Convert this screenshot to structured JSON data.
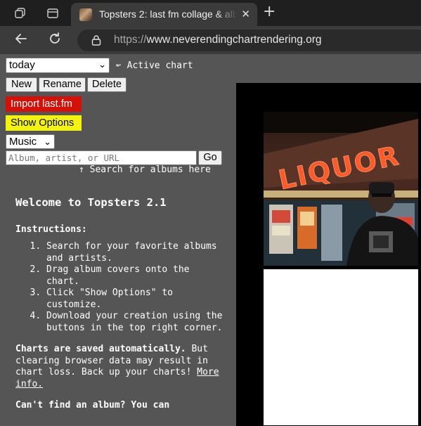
{
  "browser": {
    "tab_title": "Topsters 2: last fm collage & albu",
    "url_scheme": "https://",
    "url_host": "www.neverendingchartrendering.org"
  },
  "controls": {
    "chart_select_value": "today",
    "active_chart_label": "↜ Active chart",
    "new_label": "New",
    "rename_label": "Rename",
    "delete_label": "Delete",
    "import_label": "Import last.fm",
    "options_label": "Show Options",
    "type_select_value": "Music",
    "search_placeholder": "Album, artist, or URL",
    "go_label": "Go",
    "search_hint": "↑ Search for albums here"
  },
  "welcome": {
    "title": "Welcome to Topsters 2.1",
    "instructions_heading": "Instructions:",
    "steps": [
      "Search for your favorite albums and artists.",
      "Drag album covers onto the chart.",
      "Click \"Show Options\" to customize.",
      "Download your creation using the buttons in the top right corner."
    ],
    "saved_bold": "Charts are saved automatically.",
    "saved_text": " But clearing browser data may result in chart loss. Back up your charts! ",
    "more_info": "More info.",
    "cant_find": "Can't find an album? You can"
  },
  "cover_art": {
    "sign_text": "LIQUOR"
  }
}
